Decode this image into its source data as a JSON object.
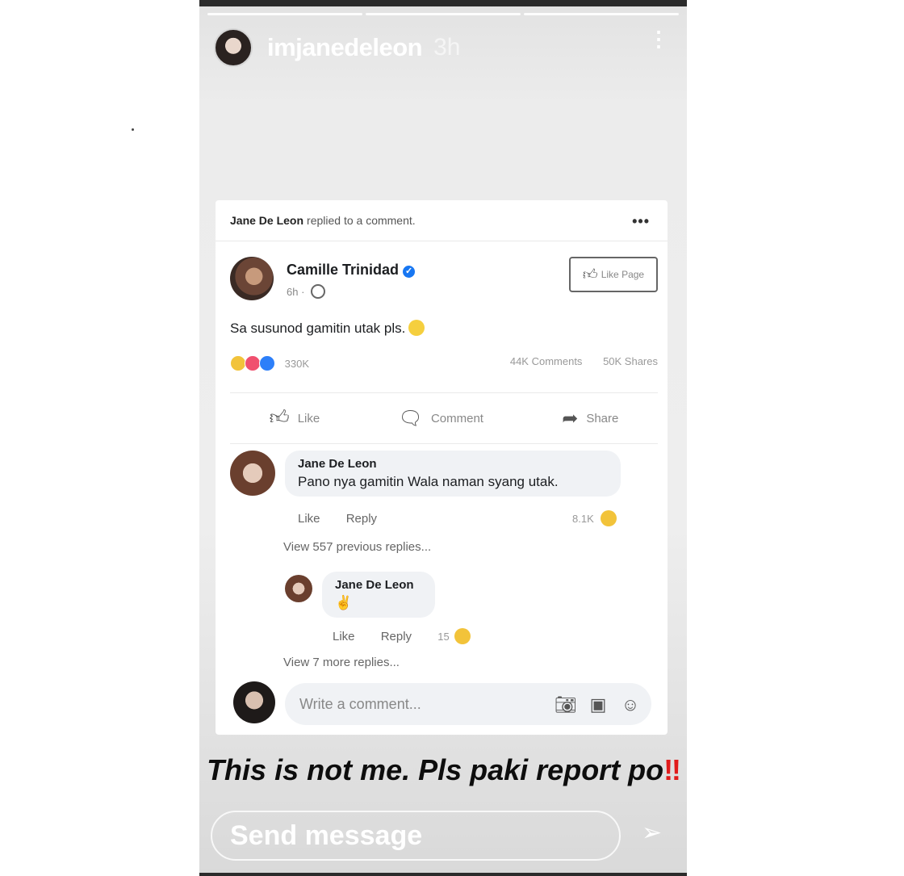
{
  "story": {
    "username": "imjanedeleon",
    "time": "3h",
    "more_glyph": "⋮",
    "caption_text": "This is not me. Pls paki report po",
    "caption_bangs": "‼",
    "send_placeholder": "Send message",
    "send_icon": "paper-plane-icon"
  },
  "fb_post": {
    "header_actor": "Jane De Leon",
    "header_action": "replied to a comment.",
    "header_more": "•••",
    "author": "Camille Trinidad",
    "verified_glyph": "✓",
    "time": "6h ·",
    "like_page_label": "Like Page",
    "body": "Sa susunod gamitin utak pls.",
    "reaction_count": "330K",
    "comments_count": "44K Comments",
    "shares_count": "50K Shares",
    "actions": {
      "like": "Like",
      "comment": "Comment",
      "share": "Share"
    }
  },
  "comments": [
    {
      "name": "Jane De Leon",
      "text": "Pano nya gamitin Wala naman syang utak.",
      "like": "Like",
      "reply": "Reply",
      "reactions": "8.1K"
    }
  ],
  "view_previous": "View 557 previous replies...",
  "reply": {
    "name": "Jane De Leon",
    "text": "✌",
    "like": "Like",
    "reply": "Reply",
    "reactions": "15"
  },
  "view_more": "View 7 more replies...",
  "write_comment": {
    "placeholder": "Write a comment...",
    "icons": [
      "camera-icon",
      "gif-icon",
      "emoji-icon"
    ]
  },
  "colors": {
    "facebook_blue": "#1877f2",
    "bang_red": "#e11b1b",
    "haha_yellow": "#f2c33a",
    "love_red": "#f0506e"
  }
}
